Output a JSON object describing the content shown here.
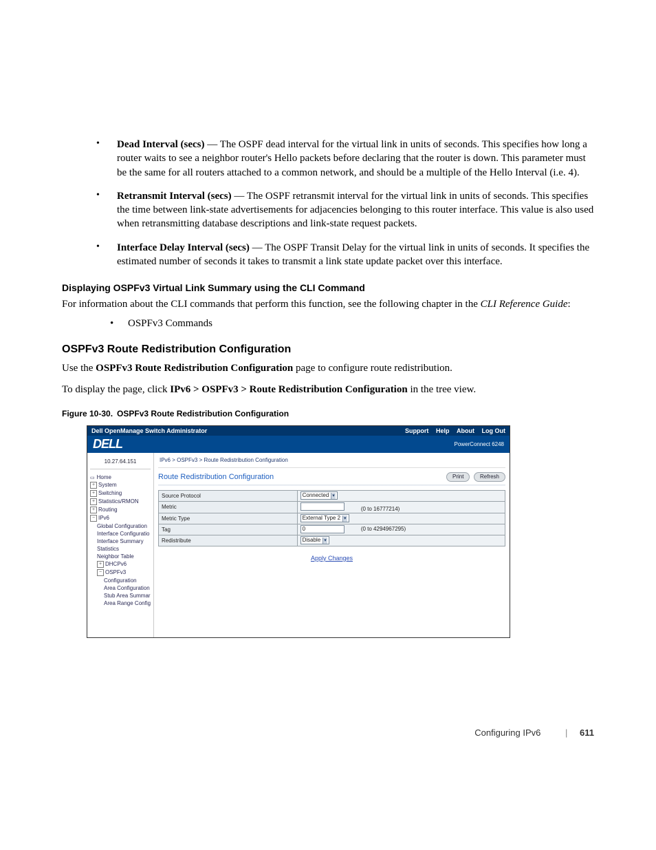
{
  "bullets": [
    {
      "term": "Dead Interval (secs)",
      "text": " — The OSPF dead interval for the virtual link in units of seconds. This specifies how long a router waits to see a neighbor router's Hello packets before declaring that the router is down. This parameter must be the same for all routers attached to a common network, and should be a multiple of the Hello Interval (i.e. 4)."
    },
    {
      "term": "Retransmit Interval (secs)",
      "text": " — The OSPF retransmit interval for the virtual link in units of seconds. This specifies the time between link-state advertisements for adjacencies belonging to this router interface. This value is also used when retransmitting database descriptions and link-state request packets."
    },
    {
      "term": "Interface Delay Interval (secs)",
      "text": " — The OSPF Transit Delay for the virtual link in units of seconds. It specifies the estimated number of seconds it takes to transmit a link state update packet over this interface."
    }
  ],
  "cli_heading": "Displaying OSPFv3 Virtual Link Summary using the CLI Command",
  "cli_intro_before": "For information about the CLI commands that perform this function, see the following chapter in the ",
  "cli_intro_ital": "CLI Reference Guide",
  "cli_intro_after": ":",
  "cli_item": "OSPFv3 Commands",
  "section_heading": "OSPFv3 Route Redistribution Configuration",
  "section_p1_a": "Use the ",
  "section_p1_b": "OSPFv3 Route Redistribution Configuration",
  "section_p1_c": " page to configure route redistribution.",
  "section_p2_a": "To display the page, click ",
  "section_p2_b": "IPv6 > OSPFv3 > Route Redistribution Configuration",
  "section_p2_c": " in the tree view.",
  "figure_caption": "Figure 10-30. OSPFv3 Route Redistribution Configuration",
  "mock": {
    "title": "Dell OpenManage Switch Administrator",
    "toplinks": [
      "Support",
      "Help",
      "About",
      "Log Out"
    ],
    "logo": "DELL",
    "product": "PowerConnect 6248",
    "ip": "10.27.64.151",
    "breadcrumb": "IPv6 > OSPFv3 > Route Redistribution Configuration",
    "panel_title": "Route Redistribution Configuration",
    "buttons": {
      "print": "Print",
      "refresh": "Refresh"
    },
    "nav": [
      {
        "label": "Home",
        "cls": "home"
      },
      {
        "label": "System",
        "exp": "+"
      },
      {
        "label": "Switching",
        "exp": "+"
      },
      {
        "label": "Statistics/RMON",
        "exp": "+"
      },
      {
        "label": "Routing",
        "exp": "+"
      },
      {
        "label": "IPv6",
        "exp": "−"
      },
      {
        "label": "Global Configuration",
        "indent": 1
      },
      {
        "label": "Interface Configuratio",
        "indent": 1
      },
      {
        "label": "Interface Summary",
        "indent": 1
      },
      {
        "label": "Statistics",
        "indent": 1
      },
      {
        "label": "Neighbor Table",
        "indent": 1
      },
      {
        "label": "DHCPv6",
        "exp": "+",
        "indent": 1
      },
      {
        "label": "OSPFv3",
        "exp": "−",
        "indent": 1
      },
      {
        "label": "Configuration",
        "indent": 2
      },
      {
        "label": "Area Configuration",
        "indent": 2
      },
      {
        "label": "Stub Area Summar",
        "indent": 2
      },
      {
        "label": "Area Range Config",
        "indent": 2
      }
    ],
    "rows": [
      {
        "label": "Source Protocol",
        "control": "select",
        "value": "Connected",
        "range": ""
      },
      {
        "label": "Metric",
        "control": "input",
        "value": "",
        "range": "(0 to 16777214)"
      },
      {
        "label": "Metric Type",
        "control": "select",
        "value": "External Type 2",
        "range": ""
      },
      {
        "label": "Tag",
        "control": "input",
        "value": "0",
        "range": "(0 to 4294967295)"
      },
      {
        "label": "Redistribute",
        "control": "select",
        "value": "Disable",
        "range": ""
      }
    ],
    "apply": "Apply Changes"
  },
  "footer": {
    "section": "Configuring IPv6",
    "page": "611"
  }
}
